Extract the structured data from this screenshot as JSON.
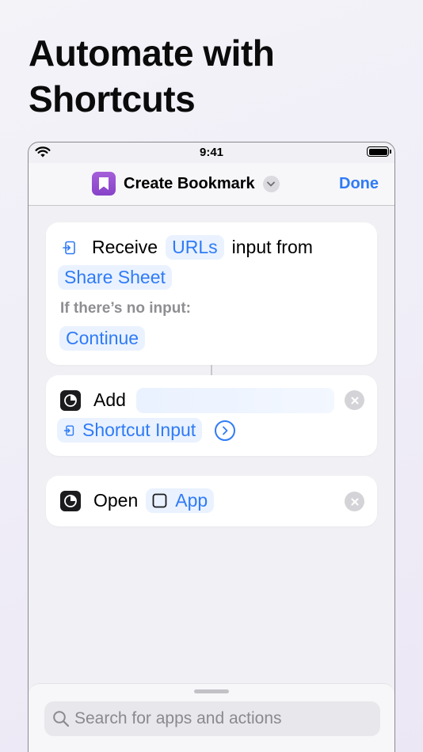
{
  "headline": {
    "line1": "Automate with",
    "line2": "Shortcuts"
  },
  "status_bar": {
    "time": "9:41"
  },
  "navbar": {
    "title": "Create Bookmark",
    "done_label": "Done"
  },
  "actions": [
    {
      "verb": "Receive",
      "input_type": "URLs",
      "connector_text": "input from",
      "source": "Share Sheet",
      "no_input_label": "If there’s no input:",
      "no_input_action": "Continue"
    },
    {
      "verb": "Add",
      "variable": "Shortcut Input"
    },
    {
      "verb": "Open",
      "target": "App"
    }
  ],
  "search": {
    "placeholder": "Search for apps and actions"
  },
  "colors": {
    "accent": "#2f7bf6",
    "token_bg": "#eaf2ff",
    "app_icon": "#9550d0"
  }
}
